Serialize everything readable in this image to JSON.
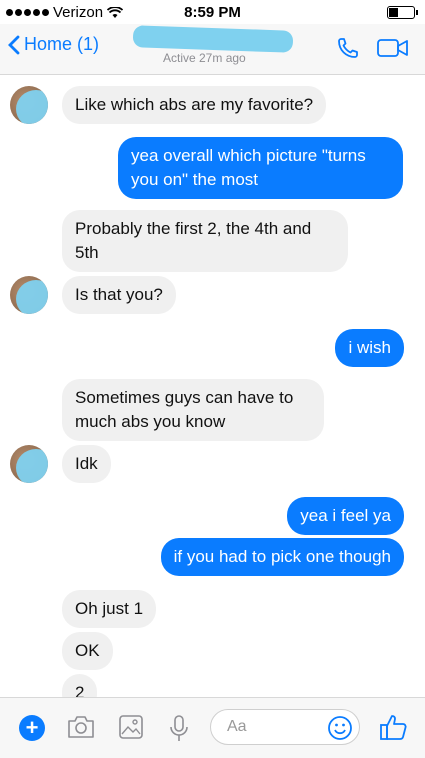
{
  "status_bar": {
    "carrier": "Verizon",
    "time": "8:59 PM"
  },
  "nav": {
    "back_label": "Home (1)",
    "active_status": "Active 27m ago"
  },
  "messages": [
    {
      "side": "in",
      "text": "Like which abs are my favorite?"
    },
    {
      "side": "out",
      "text": "yea overall which picture \"turns you on\" the most"
    },
    {
      "side": "in",
      "text": "Probably the first 2, the 4th and 5th"
    },
    {
      "side": "in",
      "text": "Is that you?"
    },
    {
      "side": "out",
      "text": "i wish"
    },
    {
      "side": "in",
      "text": "Sometimes guys can have to much abs you know"
    },
    {
      "side": "in",
      "text": "Idk"
    },
    {
      "side": "out",
      "text": "yea i feel ya"
    },
    {
      "side": "out",
      "text": "if you had to pick one though"
    },
    {
      "side": "in",
      "text": "Oh just 1"
    },
    {
      "side": "in",
      "text": "OK"
    },
    {
      "side": "in",
      "text": "2"
    }
  ],
  "composer": {
    "placeholder": "Aa"
  },
  "colors": {
    "accent": "#0a7cff",
    "incoming_bubble": "#f0f0f0",
    "redaction": "#7fd1ef"
  }
}
